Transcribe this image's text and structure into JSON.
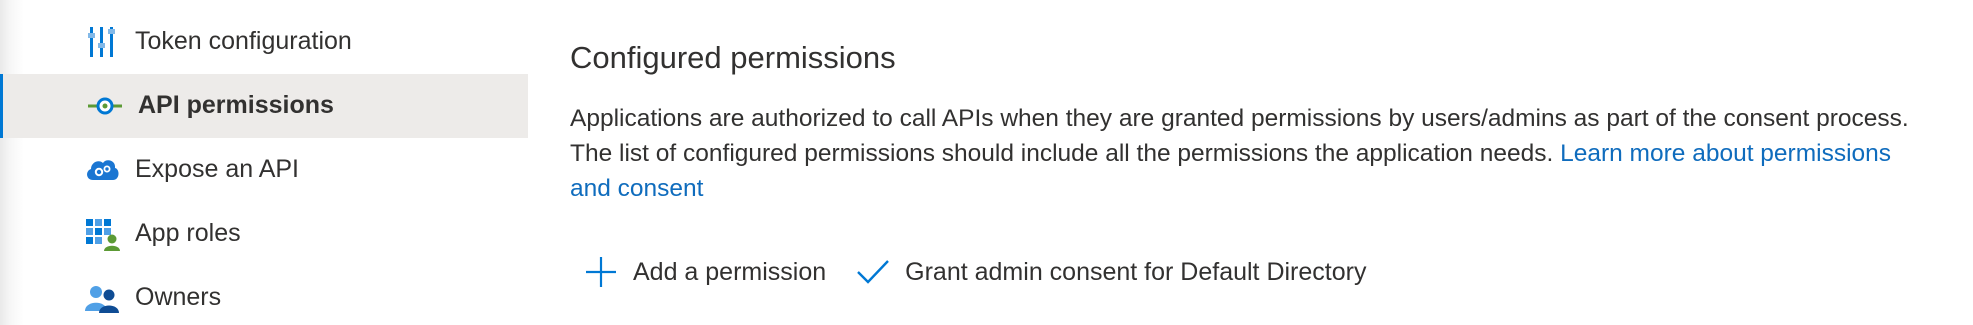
{
  "sidebar": {
    "items": [
      {
        "label": "Token configuration",
        "icon": "token-configuration-icon",
        "selected": false
      },
      {
        "label": "API permissions",
        "icon": "api-permissions-icon",
        "selected": true
      },
      {
        "label": "Expose an API",
        "icon": "expose-api-cloud-icon",
        "selected": false
      },
      {
        "label": "App roles",
        "icon": "app-roles-icon",
        "selected": false
      },
      {
        "label": "Owners",
        "icon": "owners-icon",
        "selected": false
      }
    ]
  },
  "main": {
    "title": "Configured permissions",
    "description": "Applications are authorized to call APIs when they are granted permissions by users/admins as part of the consent process. The list of configured permissions should include all the permissions the application needs.",
    "learn_more_link": "Learn more about permissions and consent",
    "commands": {
      "add_permission": "Add a permission",
      "grant_consent": "Grant admin consent for Default Directory"
    }
  },
  "colors": {
    "accent": "#0078d4",
    "link": "#0f6cbd",
    "selected_bg": "#edebe9",
    "text": "#323130"
  }
}
